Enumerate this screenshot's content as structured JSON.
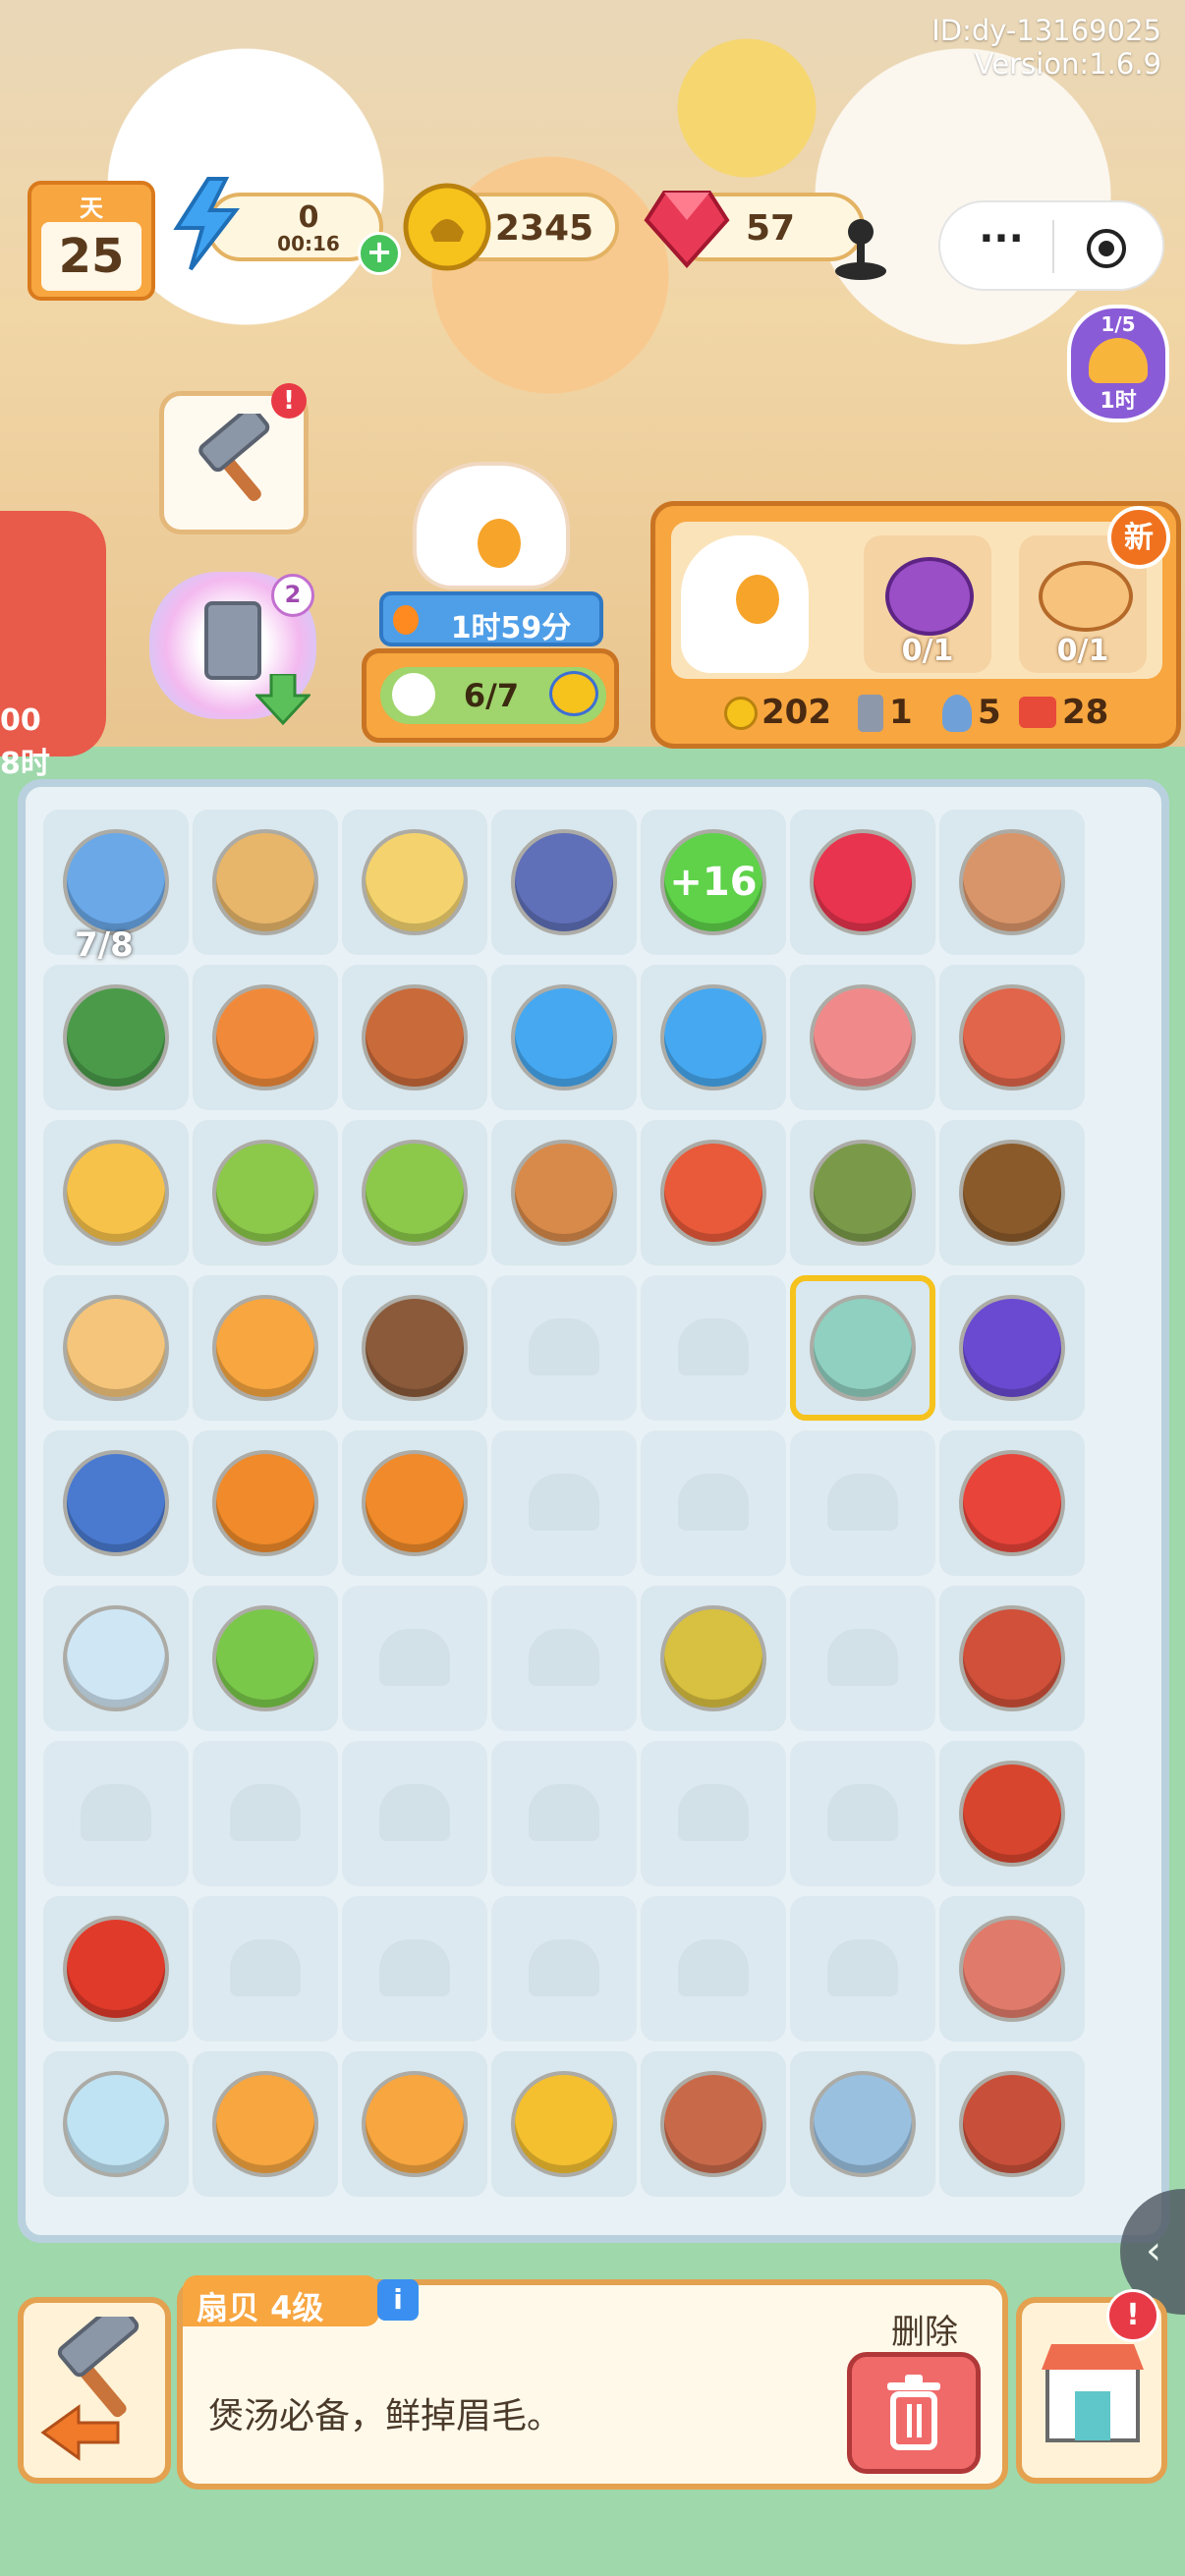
{
  "header": {
    "id_text": "ID:dy-13169025",
    "version_text": "Version:1.6.9"
  },
  "top_bar": {
    "day_label": "天",
    "day_number": "25",
    "energy_value": "0",
    "energy_timer": "00:16",
    "coins": "2345",
    "gems": "57"
  },
  "side": {
    "reward_progress": "1/5",
    "reward_time": "1时",
    "left_partial_a": "00",
    "left_partial_b": "8时",
    "pack_badge": "2"
  },
  "chef": {
    "timer": "1时59分",
    "count": "6/7"
  },
  "order": {
    "new_badge": "新",
    "req1": "0/1",
    "req2": "0/1",
    "reward_coins": "202",
    "reward_card": "1",
    "reward_tool": "5",
    "reward_box": "28"
  },
  "board": {
    "cooler_count": "7/8",
    "plus_energy": "+16"
  },
  "bottom": {
    "item_name": "扇贝 4级",
    "info_icon": "i",
    "description": "煲汤必备，鲜掉眉毛。",
    "delete_label": "删除"
  },
  "colors": {
    "board_bg": "#e8f1f5",
    "green_bg": "#9ed8ab",
    "accent_orange": "#f7a640",
    "delete_red": "#f06a6a"
  }
}
